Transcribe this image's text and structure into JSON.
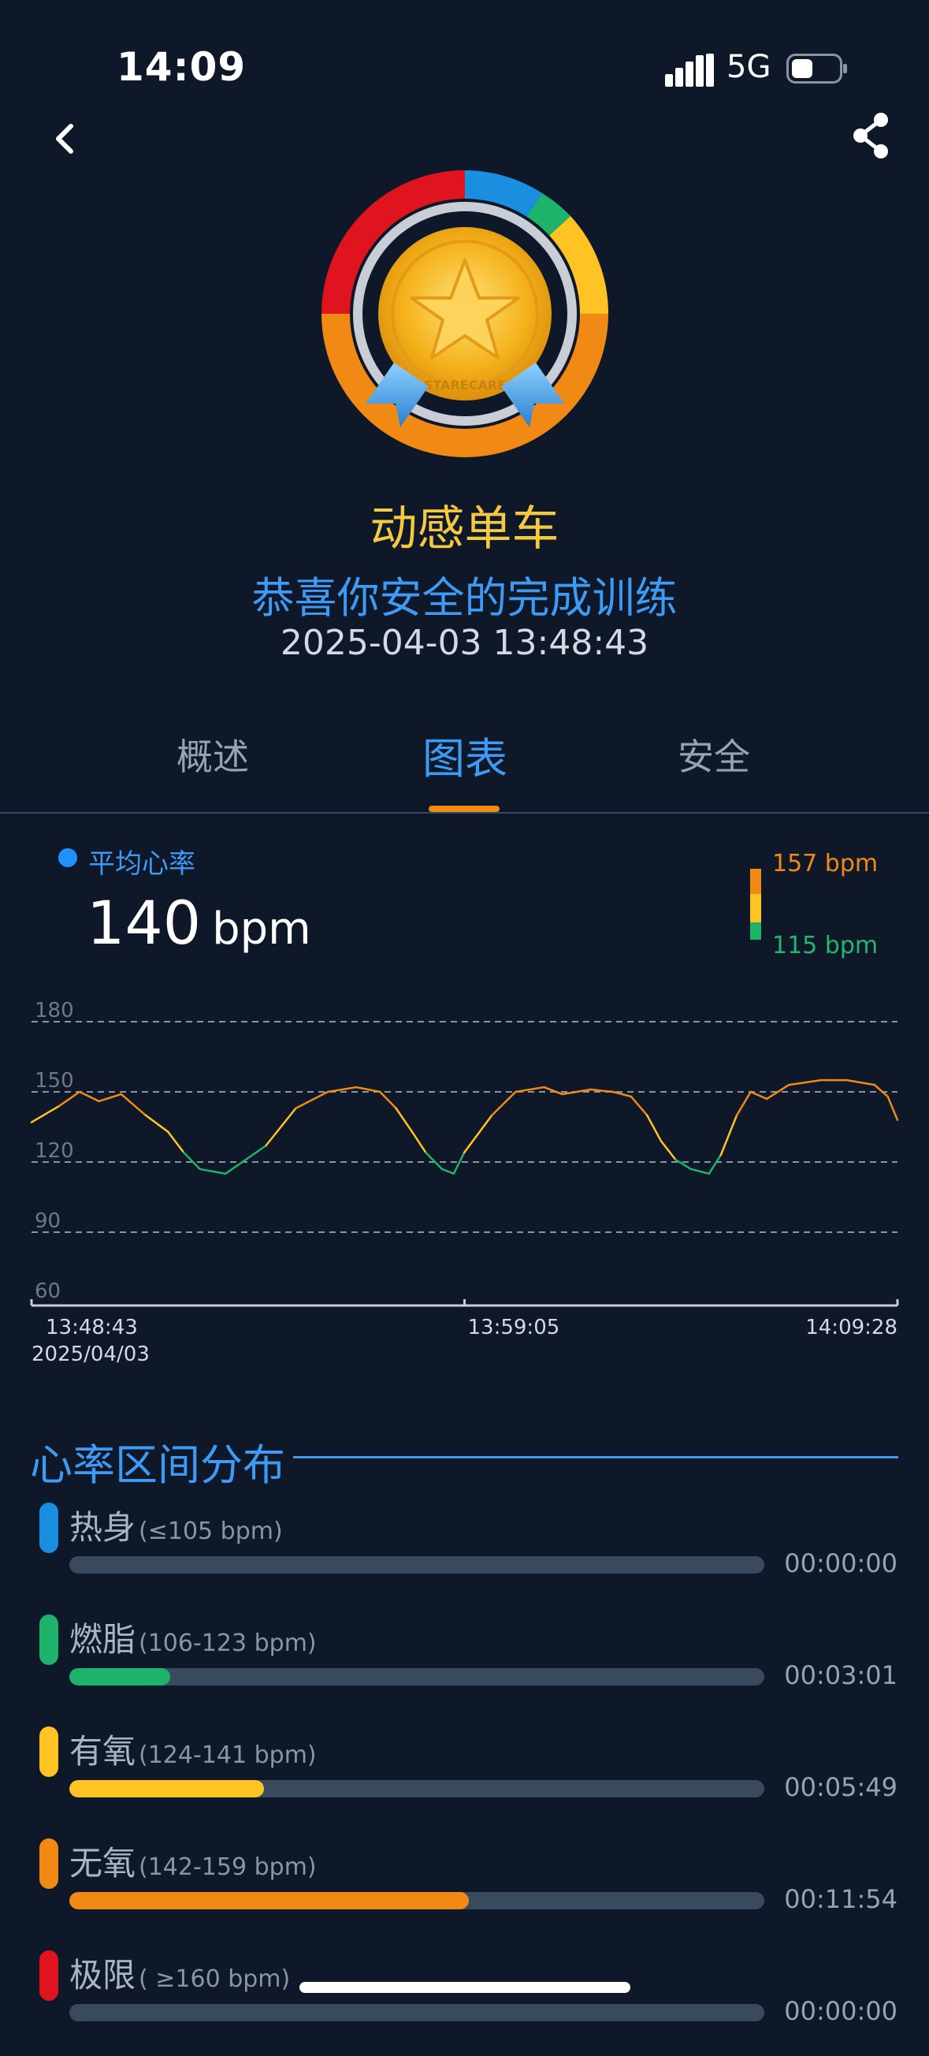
{
  "status_bar": {
    "time": "14:09",
    "network": "5G"
  },
  "header": {
    "title": "动感单车",
    "subtitle": "恭喜你安全的完成训练",
    "datetime": "2025-04-03 13:48:43",
    "medal_text": "STARECARE"
  },
  "tabs": [
    {
      "label": "概述"
    },
    {
      "label": "图表"
    },
    {
      "label": "安全"
    }
  ],
  "active_tab": "图表",
  "avg_heart_rate": {
    "label": "平均心率",
    "value": "140",
    "unit": "bpm",
    "max_label": "157 bpm",
    "min_label": "115 bpm"
  },
  "colors": {
    "background": "#0e1828",
    "accent_blue": "#3d9bf5",
    "warmup": "#1a8fe0",
    "fatburn": "#1db36b",
    "aerobic": "#ffc423",
    "anaerobic": "#f08a14",
    "extreme": "#e0141e"
  },
  "chart_data": {
    "type": "line",
    "y_ticks": [
      "180",
      "150",
      "120",
      "90",
      "60"
    ],
    "ylim": [
      60,
      180
    ],
    "grid": true,
    "x_tick_labels": [
      "13:48:43",
      "13:59:05",
      "14:09:28"
    ],
    "x_date_label": "2025/04/03",
    "series": [
      {
        "x": [
          "13:48:43",
          "13:49:23",
          "13:49:52",
          "13:50:20",
          "13:50:52",
          "13:51:27",
          "13:51:59",
          "13:52:22",
          "13:52:45",
          "13:53:22",
          "13:54:20",
          "13:55:03",
          "13:55:49",
          "13:56:30",
          "13:57:04",
          "13:57:27",
          "13:57:50",
          "13:58:10",
          "13:58:33",
          "13:58:50",
          "13:59:05",
          "13:59:45",
          "14:00:19",
          "14:01:00",
          "14:01:26",
          "14:02:07",
          "14:02:39",
          "14:03:05",
          "14:03:28",
          "14:03:48",
          "14:04:09",
          "14:04:31",
          "14:04:57",
          "14:05:14",
          "14:05:37",
          "14:05:57",
          "14:06:20",
          "14:06:52",
          "14:07:38",
          "14:08:15",
          "14:08:55",
          "14:09:14",
          "14:09:28"
        ],
        "y": [
          137,
          144,
          150,
          146,
          149,
          140,
          133,
          124,
          117,
          115,
          127,
          143,
          150,
          152,
          150,
          143,
          133,
          124,
          117,
          115,
          124,
          140,
          150,
          152,
          149,
          151,
          150,
          148,
          140,
          129,
          121,
          117,
          115,
          123,
          140,
          150,
          147,
          153,
          155,
          155,
          153,
          148,
          138
        ]
      }
    ]
  },
  "zones": {
    "title": "心率区间分布",
    "items": [
      {
        "name": "热身",
        "range": "(≤105 bpm)",
        "time": "00:00:00",
        "ratio": 0.0,
        "color": "#1a8fe0"
      },
      {
        "name": "燃脂",
        "range": "(106-123 bpm)",
        "time": "00:03:01",
        "ratio": 0.145,
        "color": "#1db36b"
      },
      {
        "name": "有氧",
        "range": "(124-141 bpm)",
        "time": "00:05:49",
        "ratio": 0.28,
        "color": "#ffc423"
      },
      {
        "name": "无氧",
        "range": "(142-159 bpm)",
        "time": "00:11:54",
        "ratio": 0.575,
        "color": "#f08a14"
      },
      {
        "name": "极限",
        "range": "( ≥160 bpm)",
        "time": "00:00:00",
        "ratio": 0.0,
        "color": "#e0141e"
      }
    ]
  }
}
